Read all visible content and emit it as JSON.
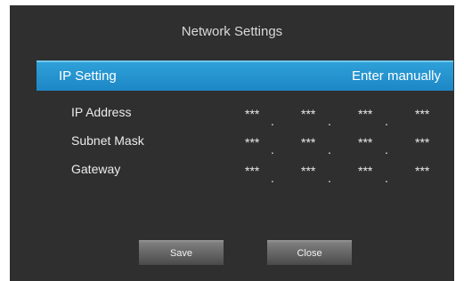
{
  "dialog": {
    "title": "Network Settings"
  },
  "ip_setting": {
    "label": "IP Setting",
    "value": "Enter manually"
  },
  "fields": [
    {
      "label": "IP Address",
      "octets": [
        "***",
        "***",
        "***",
        "***"
      ]
    },
    {
      "label": "Subnet Mask",
      "octets": [
        "***",
        "***",
        "***",
        "***"
      ]
    },
    {
      "label": "Gateway",
      "octets": [
        "***",
        "***",
        "***",
        "***"
      ]
    }
  ],
  "buttons": {
    "save": "Save",
    "close": "Close"
  },
  "colors": {
    "background": "#2f2f2f",
    "highlight": "#1d87c6"
  }
}
